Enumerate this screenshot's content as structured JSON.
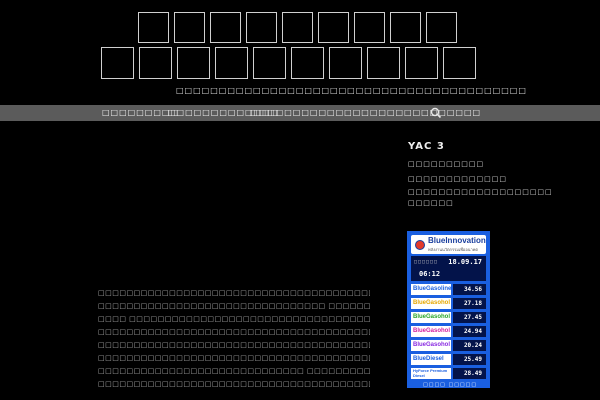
{
  "site": {
    "title_row_1_count": 9,
    "title_row_2_count": 10,
    "tagline": "□□□□□□□□□□□□□□□□□□□□□□□□□□□□□□□□□□□□□□□□□"
  },
  "nav": {
    "items": [
      {
        "label": "□□□□□□□□□"
      },
      {
        "label": "□□□□□□□□□□□□□"
      },
      {
        "label": "□□□□□□□□□□□□□□□□□□□□□□□□□□□"
      }
    ],
    "search_icon": "search-icon"
  },
  "article": {
    "lines": [
      "□□□□□□□□□□□□□□□□□□□□□□□□□□□□□□□□□□□□□□□□□□□□□",
      "□□□□□□□□□□□□□□□□□□□□□□□□□□□□□□□□ □□□□□□□□□□□□□□□□□□□ □□□□",
      "□□□□ □□□□□□□□□□□□□□□□□□□□□□□□□□□□□□□□□□□□□□□□□□□□□□□□□",
      "□□□□□□□□□□□□□□□□□□□□□□□□□□□□□□□□□□□□□□□□□□□□□□□□□□□□□",
      "□□□□□□□□□□□□□□□□□□□□□□□□□□□□□□□□□□□□□□□□□□ □□□□□□□□□□",
      "□□□□□□□□□□□□□□□□□□□□□□□□□□□□□□□□□□□□□□□□□□□□□□□□□□□□□",
      "□□□□□□□□□□□□□□□□□□□□□□□□□□□□□ □□□□□□□□□□□□□□□□□□□□□□□□",
      "□□□□□□□□□□□□□□□□□□□□□□□□□□□□□□□□□□□□□□□□□□□□□"
    ]
  },
  "sidebar": {
    "title": "YAC 3",
    "lines": [
      "□□□□□□□□□□",
      "□□□□□□□□□□□□□",
      "□□□□□□□□□□□□□□□□□□□",
      "□□□□□□"
    ]
  },
  "fuel_widget": {
    "brand": "BlueInnovation",
    "brand_sub": "พลังงานนวัตกรรมเพื่ออนาคต",
    "date_label": "□□□□□□",
    "date": "18.09.17",
    "time": "06:12",
    "colors": {
      "panel": "#1a5fe0",
      "dark": "#03134a",
      "blue": "#1a5fe0",
      "yellow": "#e6c800",
      "green": "#2aa52a",
      "magenta": "#d020a0",
      "purple": "#8a2be2"
    },
    "prices": [
      {
        "name": "BlueGasoline",
        "price": "34.56",
        "color": "#1a5fe0"
      },
      {
        "name": "BlueGasohol",
        "price": "27.18",
        "color": "#e6a800"
      },
      {
        "name": "BlueGasohol",
        "price": "27.45",
        "color": "#2aa52a"
      },
      {
        "name": "BlueGasohol",
        "price": "24.94",
        "color": "#d020a0"
      },
      {
        "name": "BlueGasohol",
        "price": "20.24",
        "color": "#8a2be2"
      },
      {
        "name": "BlueDiesel",
        "price": "25.49",
        "color": "#1a5fe0"
      },
      {
        "name": "HyForce Premium Diesel",
        "price": "28.49",
        "color": "#1a5fe0"
      }
    ],
    "footer": "□□□□ □□□□□"
  }
}
